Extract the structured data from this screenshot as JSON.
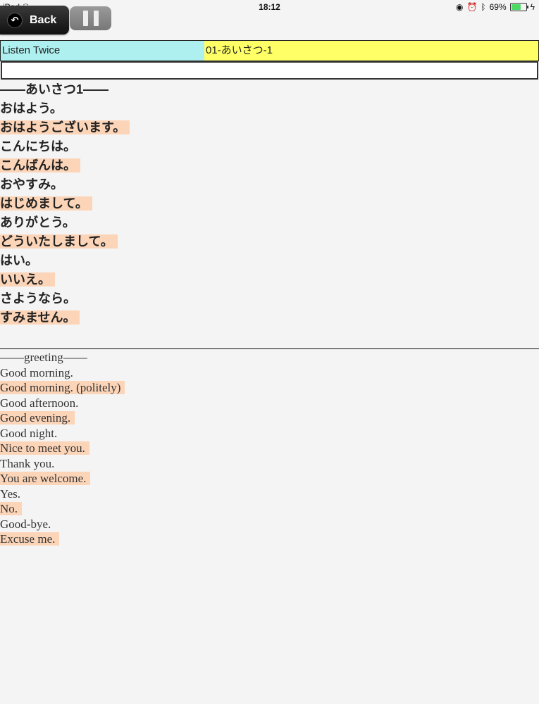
{
  "status": {
    "device": "iPad",
    "time": "18:12",
    "battery": "69%",
    "battery_level": 0.69
  },
  "toolbar": {
    "back_label": "Back"
  },
  "info": {
    "mode": "Listen Twice",
    "track": "01-あいさつ-1"
  },
  "japanese": {
    "heading": "——あいさつ1——",
    "lines": [
      "おはよう。",
      "おはようございます。",
      "こんにちは。",
      "こんばんは。",
      "おやすみ。",
      "はじめまして。",
      "ありがとう。",
      "どういたしまして。",
      "はい。",
      "いいえ。",
      "さようなら。",
      "すみません。"
    ]
  },
  "english": {
    "heading": "——greeting——",
    "lines": [
      "Good morning.",
      "Good morning. (politely)",
      "Good afternoon.",
      "Good evening.",
      "Good night.",
      "Nice to meet you.",
      "Thank you.",
      "You are welcome.",
      "Yes.",
      "No.",
      "Good-bye.",
      "Excuse me."
    ]
  }
}
